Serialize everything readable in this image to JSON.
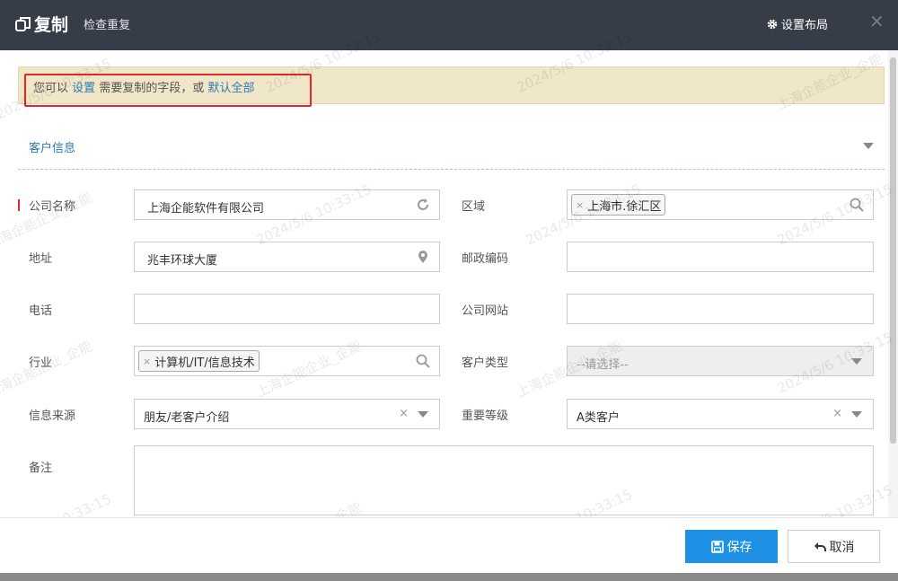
{
  "window": {
    "title": "复制",
    "subtitle": "检查重复",
    "layout_button": "设置布局",
    "close_glyph": "×"
  },
  "notice": {
    "prefix": "您可以",
    "settings_link": "设置",
    "middle": "需要复制的字段，或",
    "default_all_link": "默认全部"
  },
  "section": {
    "title": "客户信息"
  },
  "form": {
    "company_name": {
      "label": "公司名称",
      "value": "上海企能软件有限公司",
      "required": true
    },
    "region": {
      "label": "区域",
      "tag": "上海市.徐汇区"
    },
    "address": {
      "label": "地址",
      "value": "兆丰环球大厦"
    },
    "postcode": {
      "label": "邮政编码",
      "value": ""
    },
    "phone": {
      "label": "电话",
      "value": ""
    },
    "website": {
      "label": "公司网站",
      "value": ""
    },
    "industry": {
      "label": "行业",
      "tag": "计算机/IT/信息技术"
    },
    "customer_type": {
      "label": "客户类型",
      "value": "--请选择--"
    },
    "source": {
      "label": "信息来源",
      "value": "朋友/老客户介绍"
    },
    "importance": {
      "label": "重要等级",
      "value": "A类客户"
    },
    "remark": {
      "label": "备注",
      "value": ""
    }
  },
  "footer": {
    "save": "保存",
    "cancel": "取消"
  },
  "watermark": {
    "date": "2024/5/6 10:33:15",
    "company": "上海企能企业_企能"
  },
  "colors": {
    "titlebar": "#363c48",
    "accent": "#1e90e6",
    "link": "#2f7ab5",
    "notice_bg": "#f0e6c8",
    "highlight_box": "#e5262b"
  }
}
